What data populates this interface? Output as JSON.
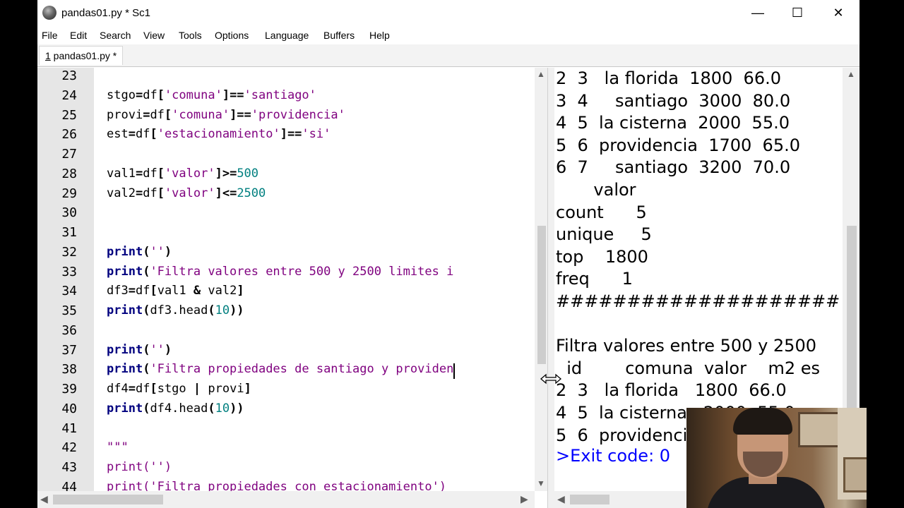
{
  "window": {
    "title": "pandas01.py * Sc1",
    "minimize_glyph": "—",
    "maximize_glyph": "☐",
    "close_glyph": "✕"
  },
  "menu": [
    "File",
    "Edit",
    "Search",
    "View",
    "Tools",
    "Options",
    "Language",
    "Buffers",
    "Help"
  ],
  "tab": {
    "number": "1",
    "label": " pandas01.py *"
  },
  "editor": {
    "line_numbers": [
      "23",
      "24",
      "25",
      "26",
      "27",
      "28",
      "29",
      "30",
      "31",
      "32",
      "33",
      "34",
      "35",
      "36",
      "37",
      "38",
      "39",
      "40",
      "41",
      "42",
      "43",
      "44"
    ],
    "lines": [
      [],
      [
        {
          "c": "id",
          "t": "stgo"
        },
        {
          "c": "op",
          "t": "="
        },
        {
          "c": "id",
          "t": "df"
        },
        {
          "c": "op",
          "t": "["
        },
        {
          "c": "str",
          "t": "'comuna'"
        },
        {
          "c": "op",
          "t": "]=="
        },
        {
          "c": "str",
          "t": "'santiago'"
        }
      ],
      [
        {
          "c": "id",
          "t": "provi"
        },
        {
          "c": "op",
          "t": "="
        },
        {
          "c": "id",
          "t": "df"
        },
        {
          "c": "op",
          "t": "["
        },
        {
          "c": "str",
          "t": "'comuna'"
        },
        {
          "c": "op",
          "t": "]=="
        },
        {
          "c": "str",
          "t": "'providencia'"
        }
      ],
      [
        {
          "c": "id",
          "t": "est"
        },
        {
          "c": "op",
          "t": "="
        },
        {
          "c": "id",
          "t": "df"
        },
        {
          "c": "op",
          "t": "["
        },
        {
          "c": "str",
          "t": "'estacionamiento'"
        },
        {
          "c": "op",
          "t": "]=="
        },
        {
          "c": "str",
          "t": "'si'"
        }
      ],
      [],
      [
        {
          "c": "id",
          "t": "val1"
        },
        {
          "c": "op",
          "t": "="
        },
        {
          "c": "id",
          "t": "df"
        },
        {
          "c": "op",
          "t": "["
        },
        {
          "c": "str",
          "t": "'valor'"
        },
        {
          "c": "op",
          "t": "]>="
        },
        {
          "c": "num",
          "t": "500"
        }
      ],
      [
        {
          "c": "id",
          "t": "val2"
        },
        {
          "c": "op",
          "t": "="
        },
        {
          "c": "id",
          "t": "df"
        },
        {
          "c": "op",
          "t": "["
        },
        {
          "c": "str",
          "t": "'valor'"
        },
        {
          "c": "op",
          "t": "]<="
        },
        {
          "c": "num",
          "t": "2500"
        }
      ],
      [],
      [],
      [
        {
          "c": "kw",
          "t": "print"
        },
        {
          "c": "op",
          "t": "("
        },
        {
          "c": "str",
          "t": "''"
        },
        {
          "c": "op",
          "t": ")"
        }
      ],
      [
        {
          "c": "kw",
          "t": "print"
        },
        {
          "c": "op",
          "t": "("
        },
        {
          "c": "str",
          "t": "'Filtra valores entre 500 y 2500 limites i"
        }
      ],
      [
        {
          "c": "id",
          "t": "df3"
        },
        {
          "c": "op",
          "t": "="
        },
        {
          "c": "id",
          "t": "df"
        },
        {
          "c": "op",
          "t": "["
        },
        {
          "c": "id",
          "t": "val1 "
        },
        {
          "c": "op",
          "t": "&"
        },
        {
          "c": "id",
          "t": " val2"
        },
        {
          "c": "op",
          "t": "]"
        }
      ],
      [
        {
          "c": "kw",
          "t": "print"
        },
        {
          "c": "op",
          "t": "("
        },
        {
          "c": "id",
          "t": "df3.head"
        },
        {
          "c": "op",
          "t": "("
        },
        {
          "c": "num",
          "t": "10"
        },
        {
          "c": "op",
          "t": "))"
        }
      ],
      [],
      [
        {
          "c": "kw",
          "t": "print"
        },
        {
          "c": "op",
          "t": "("
        },
        {
          "c": "str",
          "t": "''"
        },
        {
          "c": "op",
          "t": ")"
        }
      ],
      [
        {
          "c": "kw",
          "t": "print"
        },
        {
          "c": "op",
          "t": "("
        },
        {
          "c": "str",
          "t": "'Filtra propiedades de santiago y providen"
        }
      ],
      [
        {
          "c": "id",
          "t": "df4"
        },
        {
          "c": "op",
          "t": "="
        },
        {
          "c": "id",
          "t": "df"
        },
        {
          "c": "op",
          "t": "["
        },
        {
          "c": "id",
          "t": "stgo "
        },
        {
          "c": "op",
          "t": "|"
        },
        {
          "c": "id",
          "t": " provi"
        },
        {
          "c": "op",
          "t": "]"
        }
      ],
      [
        {
          "c": "kw",
          "t": "print"
        },
        {
          "c": "op",
          "t": "("
        },
        {
          "c": "id",
          "t": "df4.head"
        },
        {
          "c": "op",
          "t": "("
        },
        {
          "c": "num",
          "t": "10"
        },
        {
          "c": "op",
          "t": "))"
        }
      ],
      [],
      [
        {
          "c": "str",
          "t": "\"\"\""
        }
      ],
      [
        {
          "c": "str",
          "t": "print('')"
        }
      ],
      [
        {
          "c": "str",
          "t": "print('Filtra propiedades con estacionamiento')"
        }
      ]
    ]
  },
  "output": {
    "lines": [
      "2  3   la florida  1800  66.0",
      "3  4     santiago  3000  80.0",
      "4  5  la cisterna  2000  55.0",
      "5  6  providencia  1700  65.0",
      "6  7     santiago  3200  70.0",
      "       valor",
      "count      5",
      "unique     5",
      "top    1800",
      "freq      1",
      "####################",
      "",
      "Filtra valores entre 500 y 2500",
      "  id        comuna  valor    m2 es",
      "2  3   la florida   1800  66.0",
      "4  5  la cisterna   2000  55.0",
      "5  6  providencia   1700  65.0"
    ],
    "exit_code": ">Exit code: 0"
  },
  "icons": {
    "scroll_up": "▲",
    "scroll_down": "▼",
    "scroll_left": "◀",
    "scroll_right": "▶"
  }
}
